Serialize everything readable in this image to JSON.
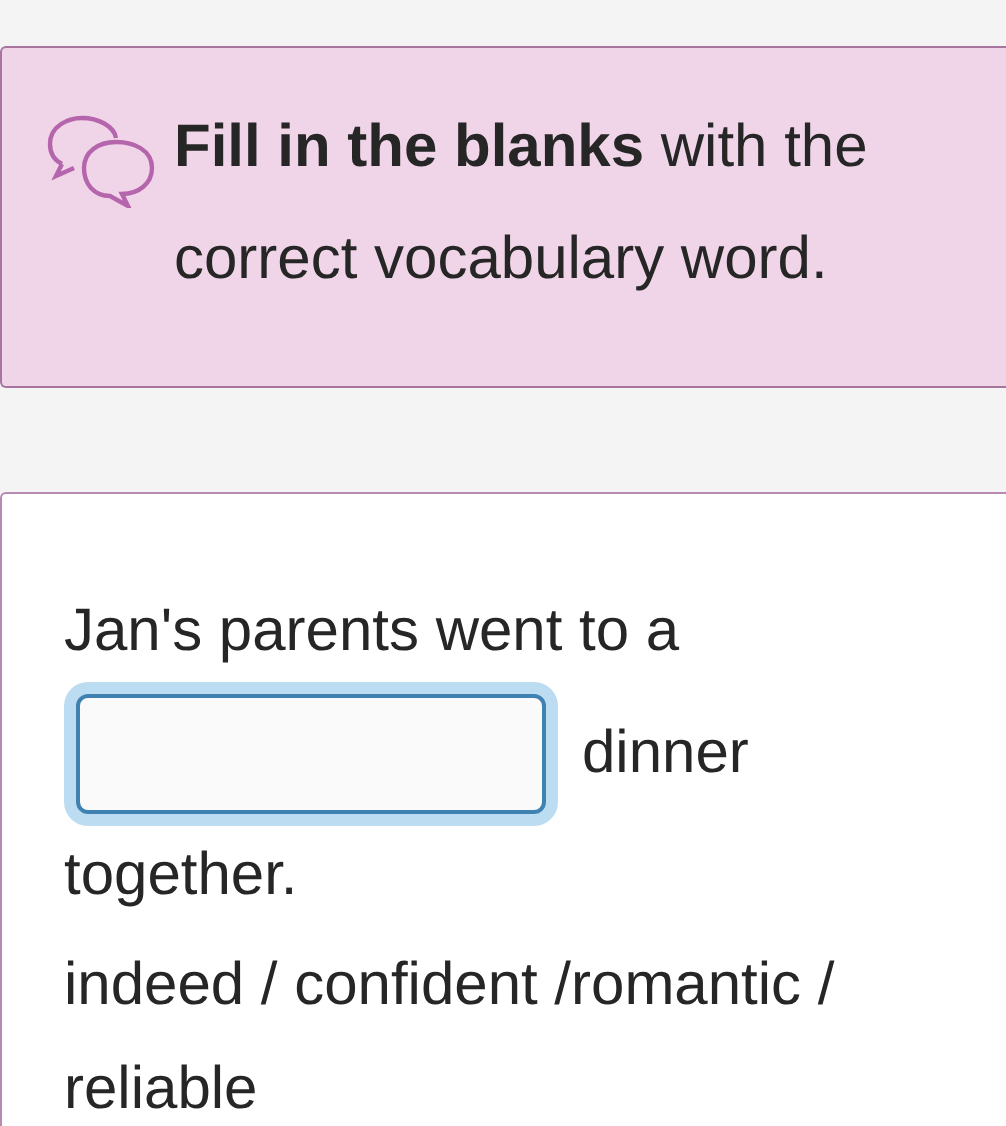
{
  "instruction": {
    "text": "**Fill in the blanks** with the correct vocabulary word."
  },
  "question": {
    "parts": [
      {
        "kind": "text",
        "text": "Jan's parents went to a"
      },
      {
        "kind": "blank",
        "focused": true
      },
      {
        "kind": "text",
        "text": "dinner"
      },
      {
        "kind": "text",
        "text": "together."
      }
    ],
    "options": "indeed / confident /romantic / reliable"
  }
}
